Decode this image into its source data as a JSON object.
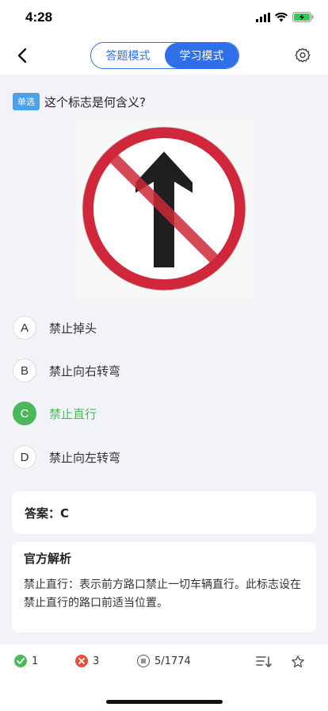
{
  "status_bar": {
    "time": "4:28"
  },
  "nav": {
    "mode_tabs": [
      {
        "label": "答题模式",
        "active": false
      },
      {
        "label": "学习模式",
        "active": true
      }
    ]
  },
  "question": {
    "type_badge": "单选",
    "text": "这个标志是何含义?"
  },
  "options": [
    {
      "letter": "A",
      "text": "禁止掉头",
      "correct": false
    },
    {
      "letter": "B",
      "text": "禁止向右转弯",
      "correct": false
    },
    {
      "letter": "C",
      "text": "禁止直行",
      "correct": true
    },
    {
      "letter": "D",
      "text": "禁止向左转弯",
      "correct": false
    }
  ],
  "answer": {
    "label": "答案：C"
  },
  "analysis": {
    "title": "官方解析",
    "text": "禁止直行：表示前方路口禁止一切车辆直行。此标志设在禁止直行的路口前适当位置。"
  },
  "bottom_bar": {
    "correct_count": "1",
    "wrong_count": "3",
    "progress": "5/1774"
  },
  "colors": {
    "accent": "#2f6fe8",
    "correct": "#4cb85c",
    "wrong": "#e8503a",
    "sign_red": "#d0283a"
  }
}
